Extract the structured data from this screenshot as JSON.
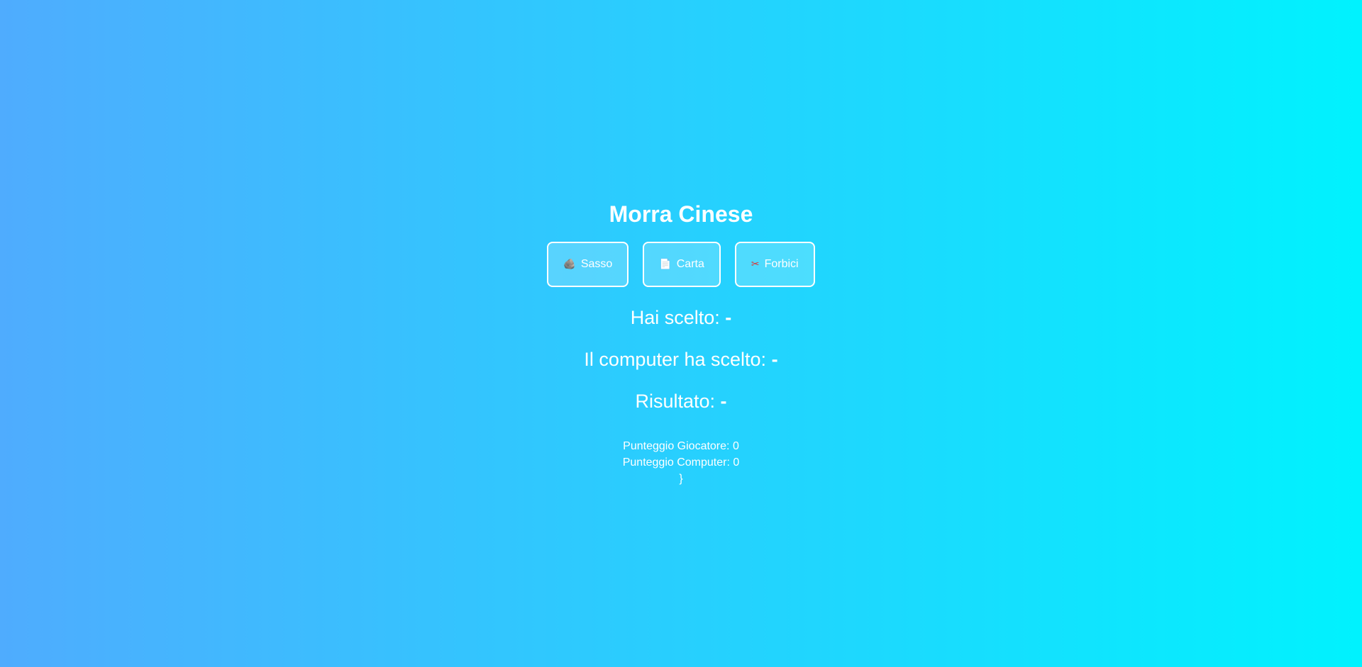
{
  "title": "Morra Cinese",
  "choices": [
    {
      "icon": "rock-icon",
      "glyph": "🪨",
      "label": "Sasso"
    },
    {
      "icon": "paper-icon",
      "glyph": "📄",
      "label": "Carta"
    },
    {
      "icon": "scissors-icon",
      "glyph": "✂",
      "label": "Forbici"
    }
  ],
  "status": {
    "player_label": "Hai scelto:",
    "player_value": "-",
    "computer_label": "Il computer ha scelto:",
    "computer_value": "-",
    "result_label": "Risultato:",
    "result_value": "-"
  },
  "scores": {
    "player_label": "Punteggio Giocatore:",
    "player_value": "0",
    "computer_label": "Punteggio Computer:",
    "computer_value": "0",
    "stray_text": "}"
  },
  "colors": {
    "gradient_start": "#4facfe",
    "gradient_end": "#00f2fe",
    "text": "#ffffff"
  }
}
